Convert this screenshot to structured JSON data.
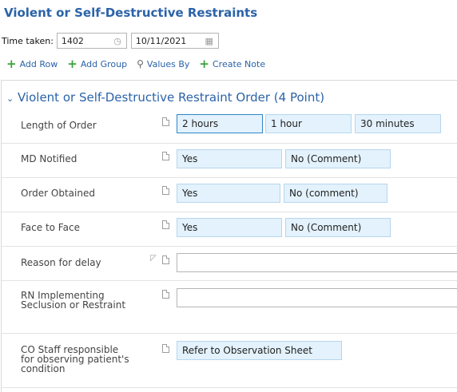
{
  "title": "Violent or Self-Destructive Restraints",
  "time_taken": {
    "label": "Time taken:",
    "time": "1402",
    "date": "10/11/2021"
  },
  "toolbar": [
    {
      "label": "Add Row",
      "icon": "plus-icon"
    },
    {
      "label": "Add Group",
      "icon": "plus-icon"
    },
    {
      "label": "Values By",
      "icon": "person-icon"
    },
    {
      "label": "Create Note",
      "icon": "plus-icon"
    }
  ],
  "section": {
    "title": "Violent or Self-Destructive Restraint Order (4 Point)",
    "expanded": true
  },
  "rows": [
    {
      "label": "Length of Order",
      "options": [
        "2 hours",
        "1 hour",
        "30 minutes"
      ],
      "selected": 0
    },
    {
      "label": "MD Notified",
      "options": [
        "Yes",
        "No (Comment)"
      ]
    },
    {
      "label": "Order Obtained",
      "options": [
        "Yes",
        "No (comment)"
      ]
    },
    {
      "label": "Face to Face",
      "options": [
        "Yes",
        "No (Comment)"
      ]
    },
    {
      "label": "Reason for delay",
      "value": ""
    },
    {
      "label": "RN Implementing Seclusion or Restraint",
      "value": ""
    },
    {
      "label": "CO Staff responsible for observing patient's condition",
      "options": [
        "Refer to Observation Sheet"
      ]
    }
  ],
  "colors": {
    "accent": "#2b63a8",
    "add": "#3aa33a",
    "option_bg": "#e3f2fc",
    "selected_border": "#2f86cc"
  }
}
